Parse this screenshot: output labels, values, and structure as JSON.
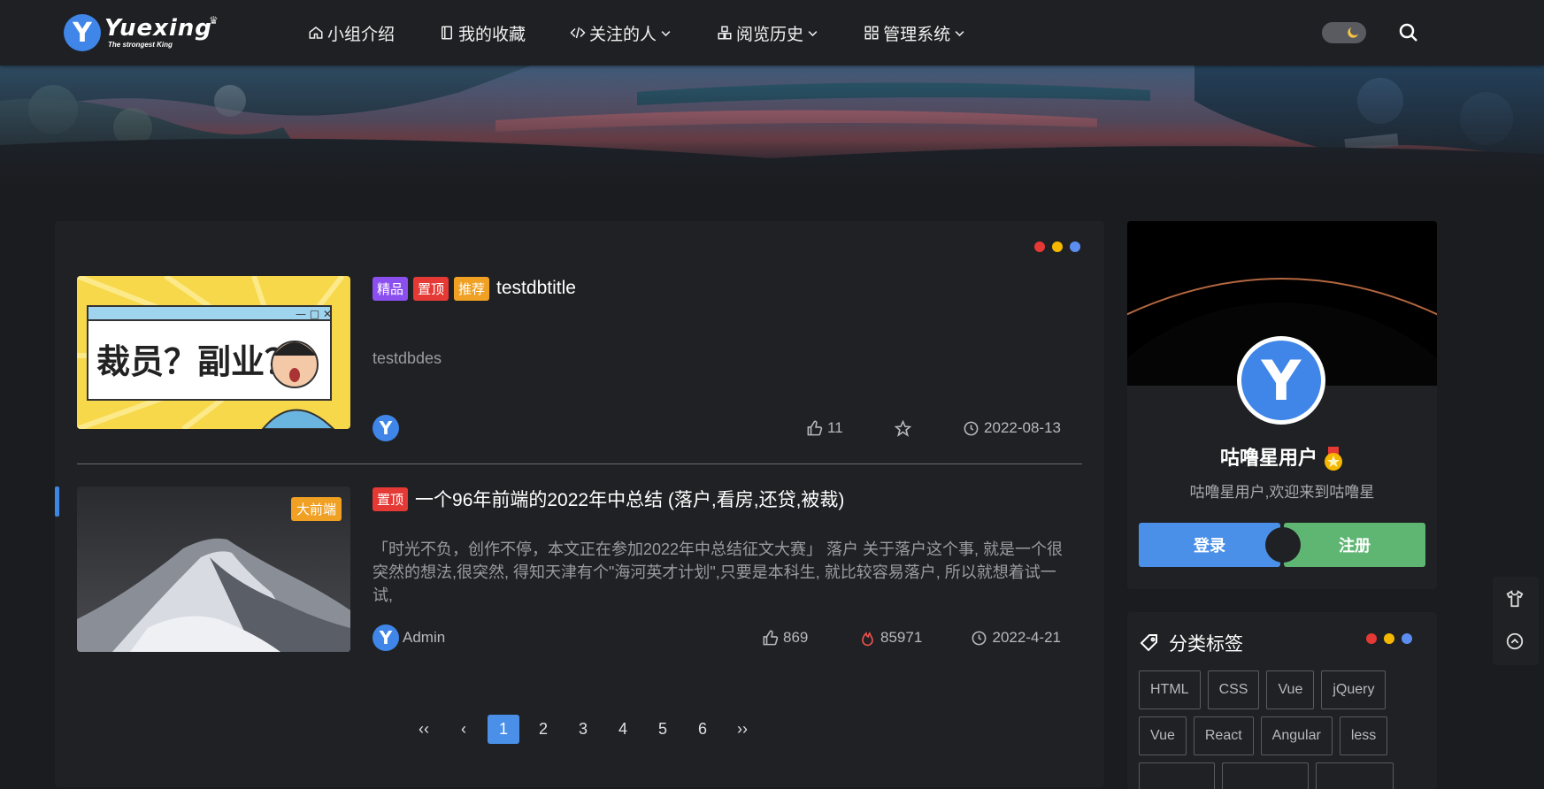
{
  "brand": {
    "name": "Yuexing",
    "slogan": "The strongest King",
    "badge_letter": "Y"
  },
  "nav": {
    "items": [
      {
        "label": "小组介绍",
        "icon": "home-icon",
        "dropdown": false
      },
      {
        "label": "我的收藏",
        "icon": "book-icon",
        "dropdown": false
      },
      {
        "label": "关注的人",
        "icon": "code-icon",
        "dropdown": true
      },
      {
        "label": "阅览历史",
        "icon": "blocks-icon",
        "dropdown": true
      },
      {
        "label": "管理系统",
        "icon": "grid-icon",
        "dropdown": true
      }
    ]
  },
  "colors": {
    "accent": "#4a90e8",
    "register": "#5fb673",
    "dot_red": "#e53935",
    "dot_yellow": "#f5b800",
    "dot_blue": "#5b8ef0",
    "tag_jingpin": "#8b4ff0",
    "tag_zhiding": "#e53935",
    "tag_tuijian": "#f0a023"
  },
  "posts": [
    {
      "tags": [
        {
          "label": "精品",
          "color": "#8b4ff0"
        },
        {
          "label": "置顶",
          "color": "#e53935"
        },
        {
          "label": "推荐",
          "color": "#f0a023"
        }
      ],
      "title": "testdbtitle",
      "excerpt": "testdbdes",
      "thumb_text": "裁员？副业？",
      "likes": "11",
      "date": "2022-08-13"
    },
    {
      "tags": [
        {
          "label": "置顶",
          "color": "#e53935"
        }
      ],
      "corner_tag": "大前端",
      "title": "一个96年前端的2022年中总结 (落户,看房,还贷,被裁)",
      "excerpt": "「时光不负，创作不停，本文正在参加2022年中总结征文大赛」 落户 关于落户这个事, 就是一个很突然的想法,很突然, 得知天津有个\"海河英才计划\",只要是本科生, 就比较容易落户, 所以就想着试一试,",
      "author": "Admin",
      "likes": "869",
      "views": "85971",
      "date": "2022-4-21"
    }
  ],
  "pagination": {
    "first": "‹‹",
    "prev": "‹",
    "pages": [
      "1",
      "2",
      "3",
      "4",
      "5",
      "6"
    ],
    "current": "1",
    "next": "››"
  },
  "profile": {
    "name": "咕噜星用户",
    "welcome": "咕噜星用户,欢迎来到咕噜星",
    "login_label": "登录",
    "register_label": "注册"
  },
  "tags_card": {
    "title": "分类标签",
    "tags": [
      "HTML",
      "CSS",
      "Vue",
      "jQuery",
      "Vue",
      "React",
      "Angular",
      "less",
      "",
      "",
      ""
    ]
  }
}
